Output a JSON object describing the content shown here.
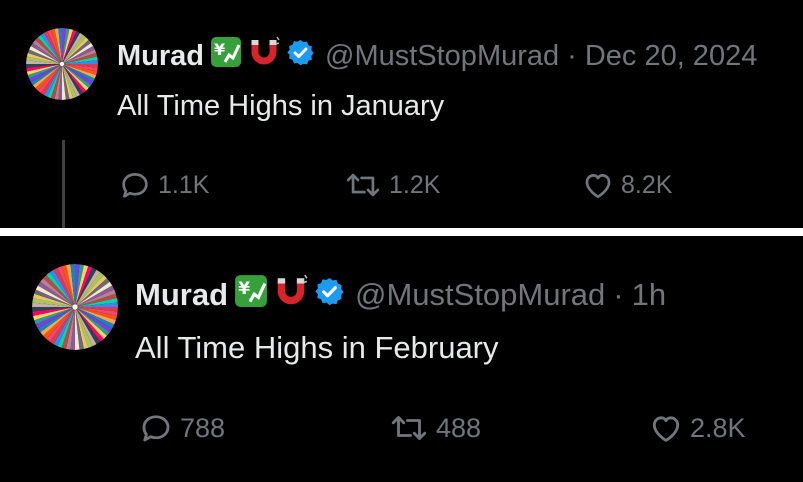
{
  "tweets": [
    {
      "name": "Murad",
      "handle": "@MustStopMurad",
      "separator": "·",
      "time": "Dec 20, 2024",
      "text": "All Time Highs in January",
      "replies": "1.1K",
      "retweets": "1.2K",
      "likes": "8.2K"
    },
    {
      "name": "Murad",
      "handle": "@MustStopMurad",
      "separator": "·",
      "time": "1h",
      "text": "All Time Highs in February",
      "replies": "788",
      "retweets": "488",
      "likes": "2.8K"
    }
  ],
  "icons": [
    "yen-chart-emoji-icon",
    "magnet-emoji-icon",
    "verified-badge-icon",
    "reply-icon",
    "retweet-icon",
    "like-icon"
  ],
  "colors": {
    "background": "#000000",
    "text": "#e7e9ea",
    "muted": "#71767b",
    "verified": "#1d9bf0",
    "emoji_green": "#36a03a",
    "magnet_red": "#d8232a"
  }
}
